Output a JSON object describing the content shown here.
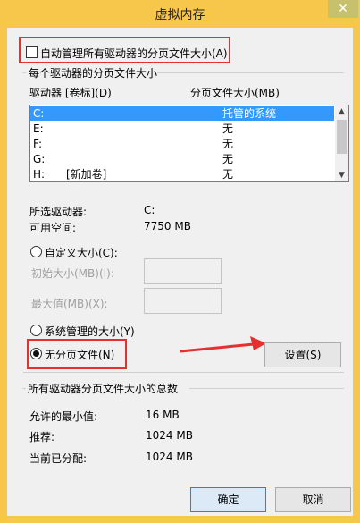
{
  "window": {
    "title": "虚拟内存",
    "close_glyph": "✕"
  },
  "auto_manage": {
    "label": "自动管理所有驱动器的分页文件大小(A)",
    "checked": false
  },
  "drives_group": {
    "title": "每个驱动器的分页文件大小",
    "col_drive": "驱动器 [卷标](D)",
    "col_size": "分页文件大小(MB)",
    "rows": [
      {
        "drive": "C:",
        "label": "",
        "size": "托管的系统",
        "selected": true
      },
      {
        "drive": "E:",
        "label": "",
        "size": "无",
        "selected": false
      },
      {
        "drive": "F:",
        "label": "",
        "size": "无",
        "selected": false
      },
      {
        "drive": "G:",
        "label": "",
        "size": "无",
        "selected": false
      },
      {
        "drive": "H:",
        "label": "[新加卷]",
        "size": "无",
        "selected": false
      }
    ],
    "selected_drive_label": "所选驱动器:",
    "selected_drive_value": "C:",
    "free_space_label": "可用空间:",
    "free_space_value": "7750 MB",
    "custom_size_label": "自定义大小(C):",
    "initial_size_label": "初始大小(MB)(I):",
    "max_size_label": "最大值(MB)(X):",
    "system_managed_label": "系统管理的大小(Y)",
    "no_paging_label": "无分页文件(N)",
    "set_button": "设置(S)"
  },
  "totals_group": {
    "title": "所有驱动器分页文件大小的总数",
    "min_allowed_label": "允许的最小值:",
    "min_allowed_value": "16 MB",
    "recommended_label": "推荐:",
    "recommended_value": "1024 MB",
    "current_label": "当前已分配:",
    "current_value": "1024 MB"
  },
  "footer": {
    "ok": "确定",
    "cancel": "取消"
  },
  "colors": {
    "title_bar": "#f6c74a",
    "annotation_red": "#e53030",
    "selection": "#3399ff"
  },
  "annotations": {
    "arrow_target": "set-button"
  }
}
